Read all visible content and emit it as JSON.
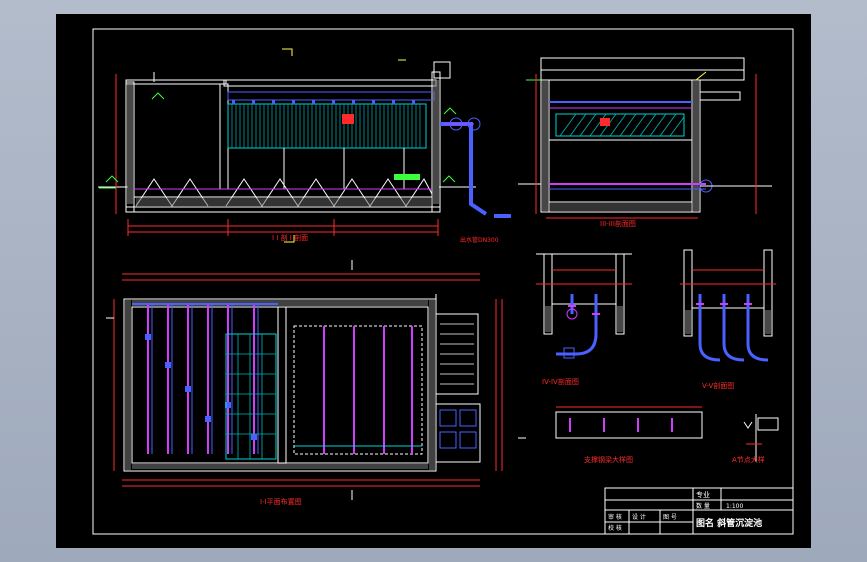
{
  "colors": {
    "viewport_bg": "#a9b3c3",
    "sheet_bg": "#000000",
    "frame": "#ffffff",
    "title_text": "#ffffff",
    "wall": "#ffffff",
    "concrete_fill": "#9a9a9a",
    "dimension": "#ff2a2a",
    "pipe_blue": "#4a60ff",
    "pipe_magenta": "#d23cff",
    "tube_cyan": "#00d4d4",
    "label_yellow": "#ffff40",
    "elevation_green": "#3cff3c"
  },
  "drawing": {
    "views": [
      {
        "id": "section-1",
        "caption": "I I 剖  I  剖面"
      },
      {
        "id": "section-3",
        "caption": "III-III剖面图"
      },
      {
        "id": "plan",
        "caption": "I-I平面布置图"
      },
      {
        "id": "section-4",
        "caption": "IV-IV剖面图"
      },
      {
        "id": "section-5",
        "caption": "V-V剖面图"
      },
      {
        "id": "detail-a",
        "caption": "支撑钢梁大样图"
      },
      {
        "id": "detail-b",
        "caption": "A节点大样"
      }
    ],
    "pipe_note": "出水管DN300"
  },
  "title_block": {
    "designer_label": "专业",
    "count_label": "数  量",
    "scale_marks": "1:100",
    "left_labels": [
      "审 核",
      "校 核",
      "设 计"
    ],
    "grid_label": "图 号",
    "title": "图名  斜管沉淀池"
  }
}
